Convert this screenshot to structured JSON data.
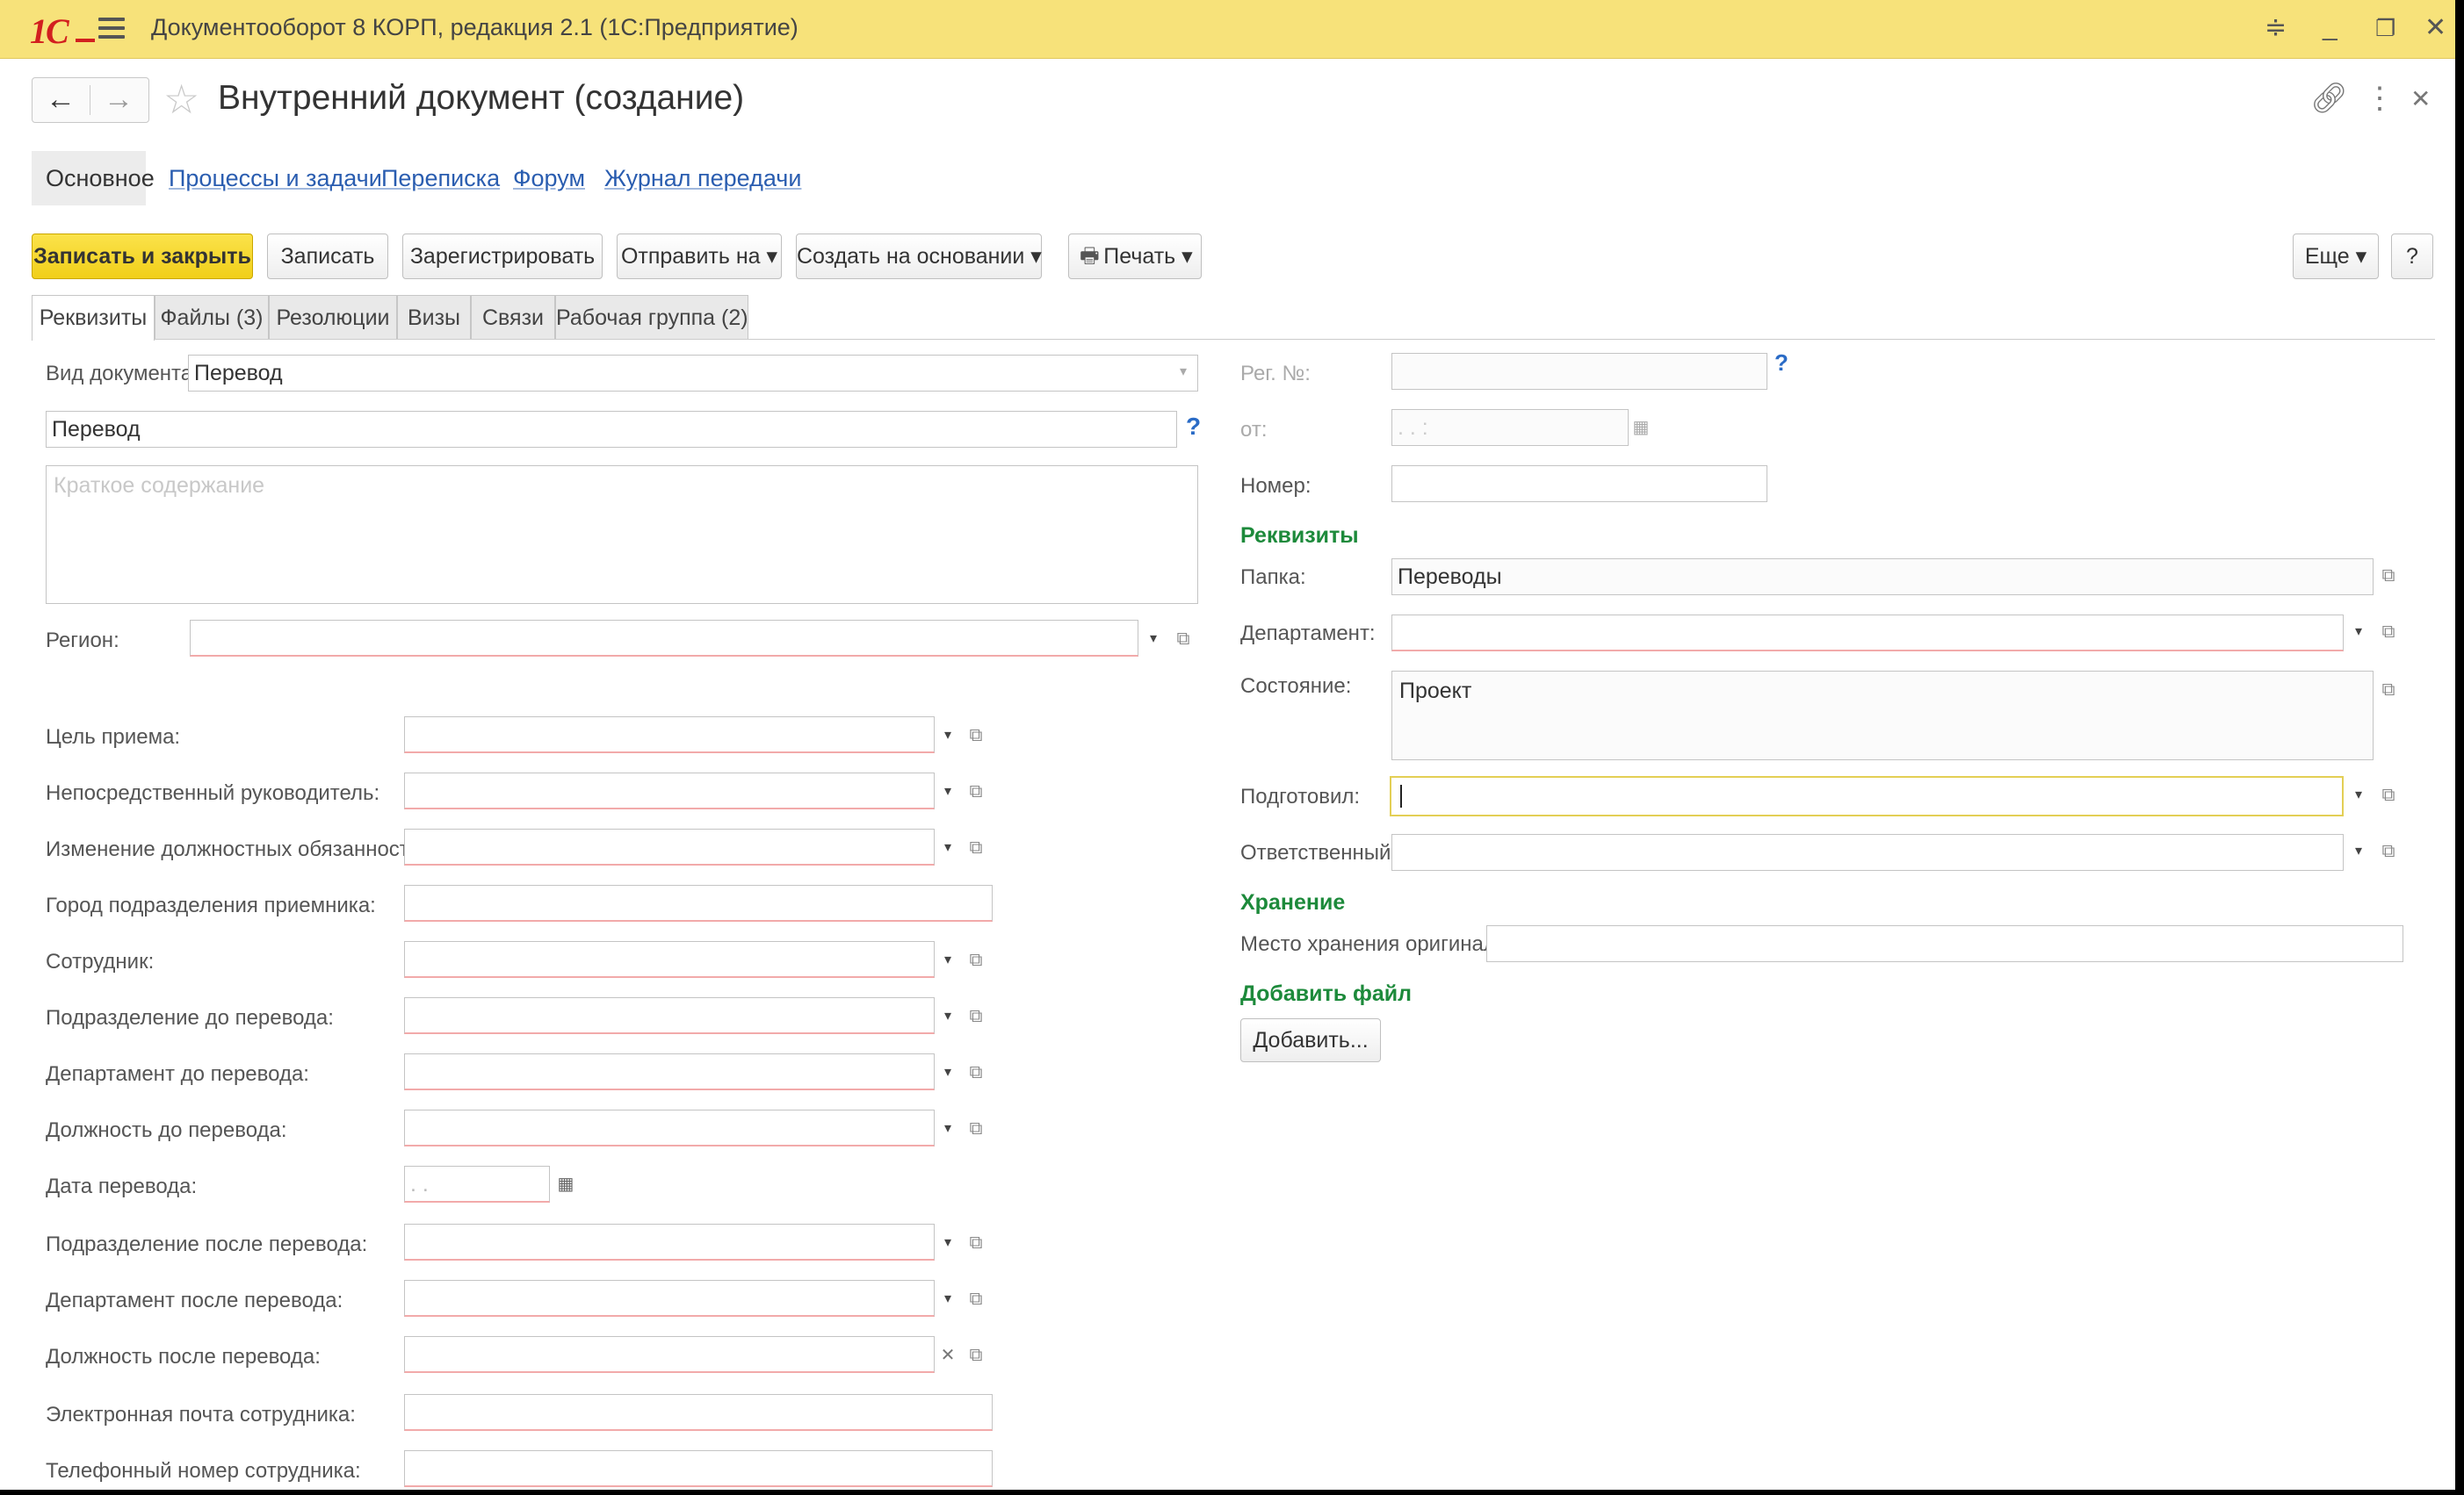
{
  "titlebar": {
    "logo": "1С",
    "app_title": "Документооборот 8 КОРП, редакция 2.1  (1С:Предприятие)"
  },
  "header": {
    "back_icon": "←",
    "forward_icon": "→",
    "star_icon": "☆",
    "title": "Внутренний документ (создание)"
  },
  "sections": {
    "active": "Основное",
    "links": [
      "Процессы и задачи",
      "Переписка",
      "Форум",
      "Журнал передачи"
    ]
  },
  "toolbar": {
    "save_close": "Записать и закрыть",
    "save": "Записать",
    "register": "Зарегистрировать",
    "send": "Отправить на  ▾",
    "create_based": "Создать на основании  ▾",
    "print": "Печать  ▾",
    "more": "Еще  ▾",
    "help": "?"
  },
  "tabs": [
    "Реквизиты",
    "Файлы (3)",
    "Резолюции",
    "Визы",
    "Связи",
    "Рабочая группа (2)"
  ],
  "left": {
    "doc_type_label": "Вид документа:",
    "doc_type_value": "Перевод",
    "title_value": "Перевод",
    "summary_placeholder": "Краткое содержание",
    "region_label": "Регион:",
    "fields": [
      {
        "label": "Цель приема:",
        "value": ""
      },
      {
        "label": "Непосредственный руководитель:",
        "value": ""
      },
      {
        "label": "Изменение должностных обязанностей:",
        "value": ""
      },
      {
        "label": "Город подразделения приемника:",
        "value": ""
      },
      {
        "label": "Сотрудник:",
        "value": ""
      },
      {
        "label": "Подразделение до перевода:",
        "value": ""
      },
      {
        "label": "Департамент до перевода:",
        "value": ""
      },
      {
        "label": "Должность до перевода:",
        "value": ""
      },
      {
        "label": "Дата перевода:",
        "value": " .  . "
      },
      {
        "label": "Подразделение после перевода:",
        "value": ""
      },
      {
        "label": "Департамент после перевода:",
        "value": ""
      },
      {
        "label": "Должность после перевода:",
        "value": ""
      },
      {
        "label": "Электронная почта сотрудника:",
        "value": ""
      },
      {
        "label": "Телефонный номер сотрудника:",
        "value": ""
      }
    ]
  },
  "right": {
    "reg_no_label": "Рег. №:",
    "from_label": "от:",
    "from_value": " .  .     :  ",
    "number_label": "Номер:",
    "group_requisites": "Реквизиты",
    "folder_label": "Папка:",
    "folder_value": "Переводы",
    "department_label": "Департамент:",
    "state_label": "Состояние:",
    "state_value": "Проект",
    "prepared_label": "Подготовил:",
    "responsible_label": "Ответственный:",
    "group_storage": "Хранение",
    "storage_label": "Место хранения оригинала:",
    "group_add_file": "Добавить файл",
    "add_button": "Добавить..."
  },
  "colors": {
    "titlebar_bg": "#f7e27a",
    "primary_button": "#f1cf19",
    "link": "#2a5db0",
    "group_header": "#1d8a3b",
    "required_underline": "#f2aaaa"
  }
}
